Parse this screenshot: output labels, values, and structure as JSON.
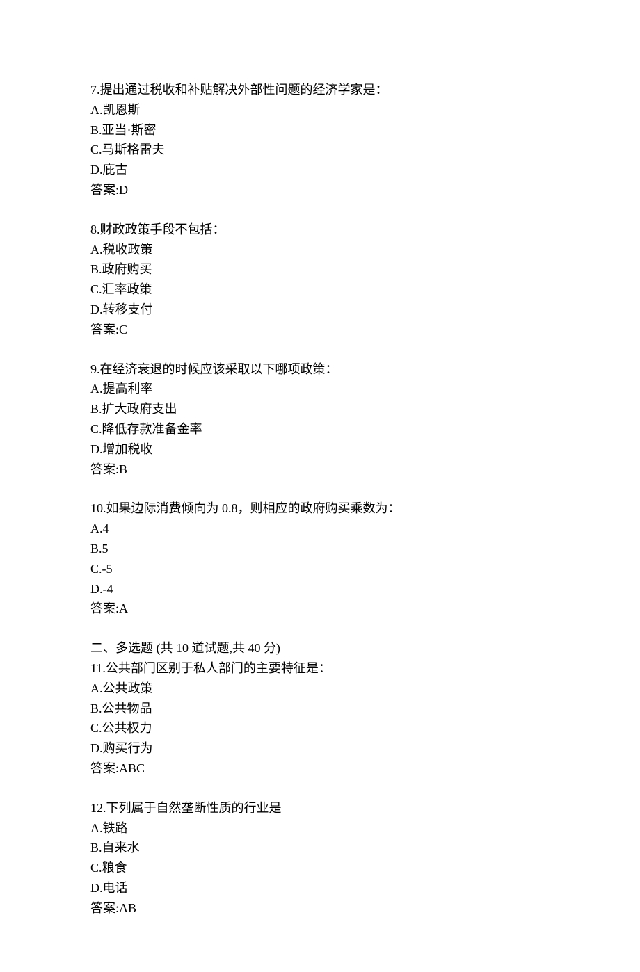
{
  "questions": [
    {
      "number": "7",
      "text": "提出通过税收和补贴解决外部性问题的经济学家是：",
      "options": [
        {
          "label": "A",
          "text": "凯恩斯"
        },
        {
          "label": "B",
          "text": "亚当·斯密"
        },
        {
          "label": "C",
          "text": "马斯格雷夫"
        },
        {
          "label": "D",
          "text": "庇古"
        }
      ],
      "answer_label": "答案:",
      "answer": "D"
    },
    {
      "number": "8",
      "text": "财政政策手段不包括：",
      "options": [
        {
          "label": "A",
          "text": "税收政策"
        },
        {
          "label": "B",
          "text": "政府购买"
        },
        {
          "label": "C",
          "text": "汇率政策"
        },
        {
          "label": "D",
          "text": "转移支付"
        }
      ],
      "answer_label": "答案:",
      "answer": "C"
    },
    {
      "number": "9",
      "text": "在经济衰退的时候应该采取以下哪项政策：",
      "options": [
        {
          "label": "A",
          "text": "提高利率"
        },
        {
          "label": "B",
          "text": "扩大政府支出"
        },
        {
          "label": "C",
          "text": "降低存款准备金率"
        },
        {
          "label": "D",
          "text": "增加税收"
        }
      ],
      "answer_label": "答案:",
      "answer": "B"
    },
    {
      "number": "10",
      "text": "如果边际消费倾向为 0.8，则相应的政府购买乘数为：",
      "options": [
        {
          "label": "A",
          "text": "4"
        },
        {
          "label": "B",
          "text": "5"
        },
        {
          "label": "C",
          "text": "-5"
        },
        {
          "label": "D",
          "text": "-4"
        }
      ],
      "answer_label": "答案:",
      "answer": "A"
    }
  ],
  "section2": {
    "header": "二、多选题 (共 10 道试题,共 40 分)"
  },
  "multi_questions": [
    {
      "number": "11",
      "text": "公共部门区别于私人部门的主要特征是：",
      "options": [
        {
          "label": "A",
          "text": "公共政策"
        },
        {
          "label": "B",
          "text": "公共物品"
        },
        {
          "label": "C",
          "text": "公共权力"
        },
        {
          "label": "D",
          "text": "购买行为"
        }
      ],
      "answer_label": "答案:",
      "answer": "ABC"
    },
    {
      "number": "12",
      "text": "下列属于自然垄断性质的行业是",
      "options": [
        {
          "label": "A",
          "text": "铁路"
        },
        {
          "label": "B",
          "text": "自来水"
        },
        {
          "label": "C",
          "text": "粮食"
        },
        {
          "label": "D",
          "text": "电话"
        }
      ],
      "answer_label": "答案:",
      "answer": "AB"
    }
  ]
}
